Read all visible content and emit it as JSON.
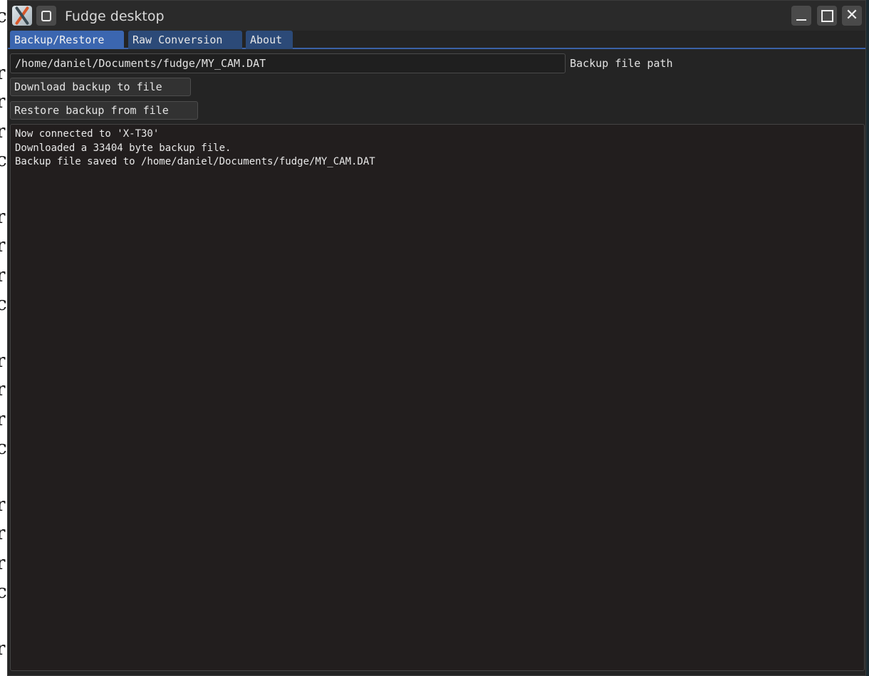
{
  "window": {
    "title": "Fudge desktop",
    "icons": {
      "app": "fudge-app-icon",
      "keep_above": "keep-above-icon",
      "minimize": "minimize-icon",
      "maximize": "maximize-icon",
      "close": "close-icon"
    },
    "close_glyph": "✕"
  },
  "tabs": [
    {
      "label": "Backup/Restore",
      "active": true
    },
    {
      "label": "Raw Conversion",
      "active": false
    },
    {
      "label": "About",
      "active": false
    }
  ],
  "backup": {
    "path_value": "/home/daniel/Documents/fudge/MY_CAM.DAT",
    "path_label": "Backup file path",
    "download_label": "Download backup to file",
    "restore_label": "Restore backup from file"
  },
  "log": {
    "lines": [
      "Now connected to 'X-T30'",
      "Downloaded a 33404 byte backup file.",
      "Backup file saved to /home/daniel/Documents/fudge/MY_CAM.DAT"
    ]
  },
  "colors": {
    "accent": "#3b66b0",
    "tab_inactive": "#2c4a78",
    "window_bg": "#242424",
    "log_bg": "#221e1e"
  }
}
